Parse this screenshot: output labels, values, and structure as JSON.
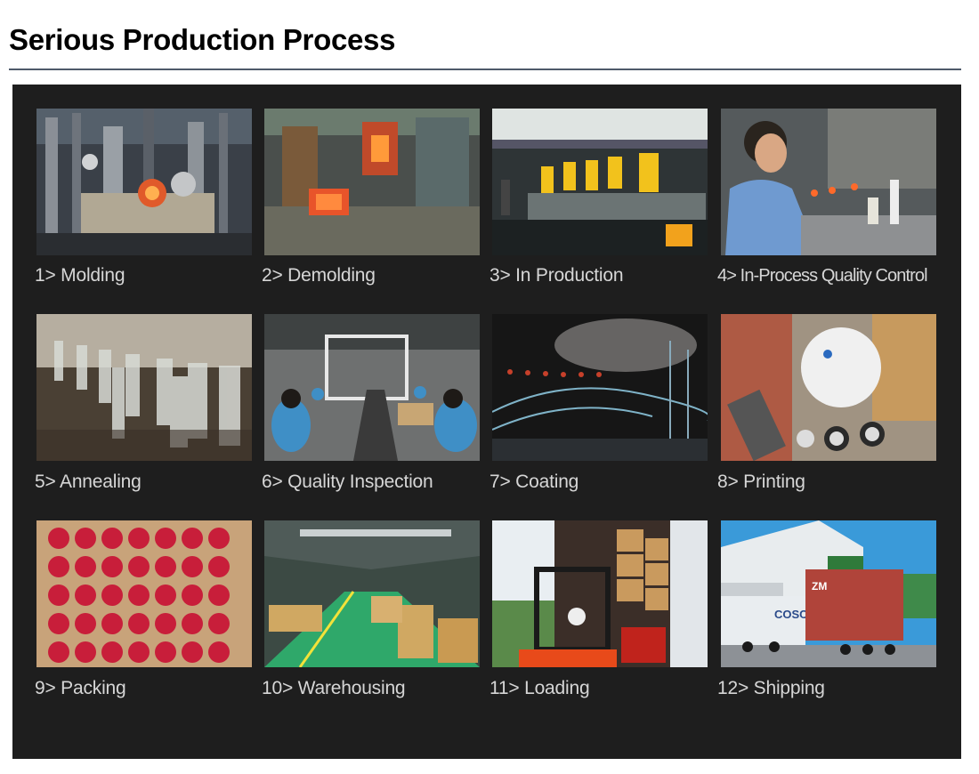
{
  "page": {
    "title": "Serious Production Process"
  },
  "steps": [
    {
      "label": "1> Molding",
      "image": "molding-machine-photo"
    },
    {
      "label": "2> Demolding",
      "image": "demolding-photo"
    },
    {
      "label": "3> In Production",
      "image": "production-line-photo"
    },
    {
      "label": "4> In-Process Quality Control",
      "image": "quality-control-worker-photo"
    },
    {
      "label": "5> Annealing",
      "image": "annealing-bottles-photo"
    },
    {
      "label": "6> Quality Inspection",
      "image": "inspection-line-photo"
    },
    {
      "label": "7>  Coating",
      "image": "coating-photo"
    },
    {
      "label": "8> Printing",
      "image": "printing-machine-photo"
    },
    {
      "label": "9> Packing",
      "image": "packed-bottles-box-photo"
    },
    {
      "label": "10> Warehousing",
      "image": "warehouse-photo"
    },
    {
      "label": "11> Loading",
      "image": "forklift-loading-photo"
    },
    {
      "label": "12> Shipping",
      "image": "container-trucks-photo"
    }
  ],
  "truck_text": {
    "container_brand": "COSC",
    "container_mark": "ZM"
  }
}
